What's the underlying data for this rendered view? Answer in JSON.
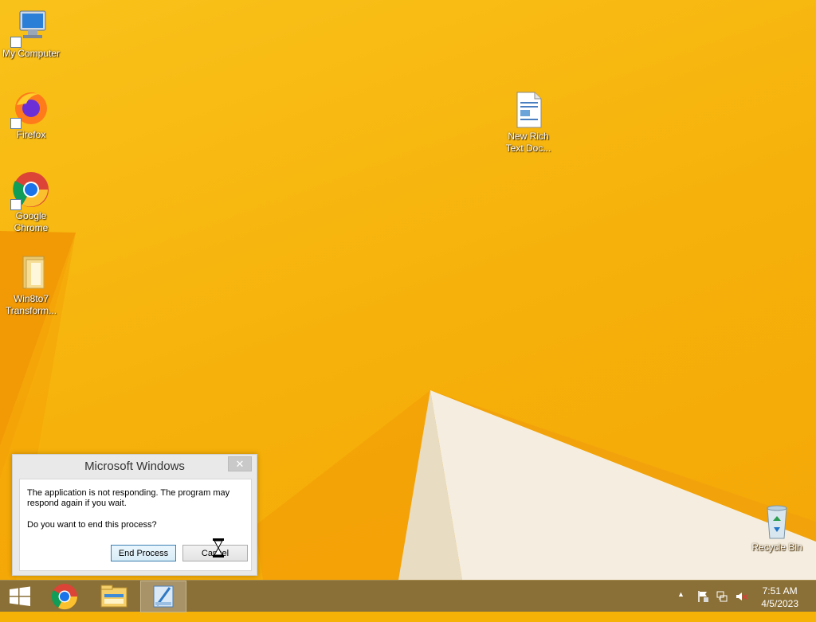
{
  "desktop": {
    "icons": [
      {
        "label": "My Computer"
      },
      {
        "label": "Firefox"
      },
      {
        "label": "Google\nChrome"
      },
      {
        "label": "Win8to7\nTransform..."
      },
      {
        "label": "New Rich\nText Doc..."
      },
      {
        "label": "Recycle Bin"
      }
    ]
  },
  "dialog": {
    "title": "Microsoft Windows",
    "close_glyph": "✕",
    "message": "The application is not responding. The program may respond again if you wait.",
    "question": "Do you want to end this process?",
    "end_process_label": "End Process",
    "cancel_label": "Cancel"
  },
  "taskbar": {
    "time": "7:51 AM",
    "date": "4/5/2023",
    "tray_chevron": "▲"
  },
  "colors": {
    "wallpaper": "#f7b208",
    "taskbar": "#8a6f37",
    "dialog_bg": "#e9e9e9",
    "accent_button": "#3c7fb1"
  }
}
